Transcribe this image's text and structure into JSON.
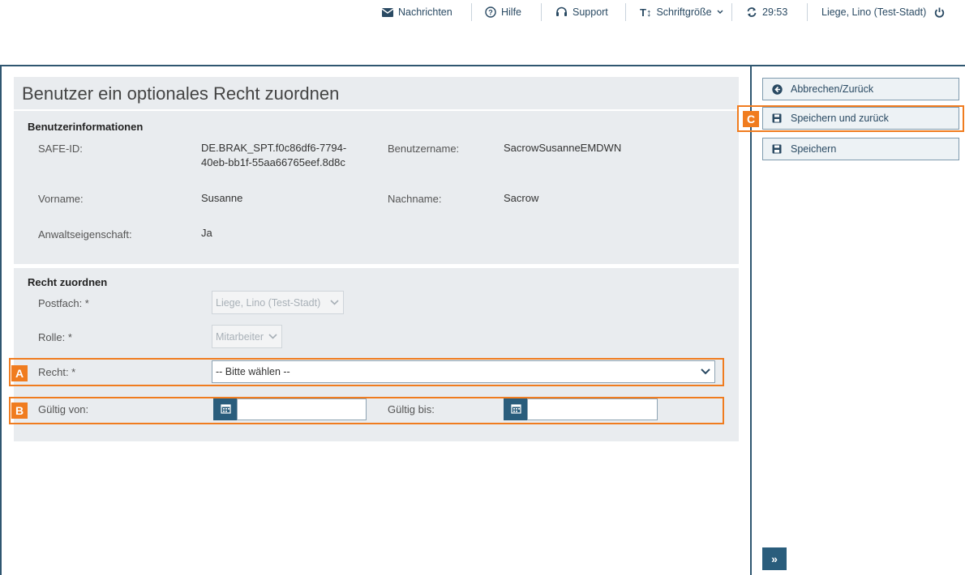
{
  "topbar": {
    "messages": "Nachrichten",
    "help": "Hilfe",
    "support": "Support",
    "font_size": "Schriftgröße",
    "timer": "29:53",
    "user": "Liege, Lino (Test-Stadt)"
  },
  "page": {
    "title": "Benutzer ein optionales Recht zuordnen"
  },
  "user_info": {
    "heading": "Benutzerinformationen",
    "safe_id_label": "SAFE-ID:",
    "safe_id_line1": "DE.BRAK_SPT.f0c86df6-7794-",
    "safe_id_line2": "40eb-bb1f-55aa66765eef.8d8c",
    "username_label": "Benutzername:",
    "username_value": "SacrowSusanneEMDWN",
    "firstname_label": "Vorname:",
    "firstname_value": "Susanne",
    "lastname_label": "Nachname:",
    "lastname_value": "Sacrow",
    "attorney_label": "Anwaltseigenschaft:",
    "attorney_value": "Ja"
  },
  "assign": {
    "heading": "Recht zuordnen",
    "mailbox_label": "Postfach: *",
    "mailbox_value": "Liege, Lino (Test-Stadt)",
    "role_label": "Rolle: *",
    "role_value": "Mitarbeiter",
    "right_label": "Recht: *",
    "right_value": "-- Bitte wählen --",
    "valid_from_label": "Gültig von:",
    "valid_from_value": "",
    "valid_to_label": "Gültig bis:",
    "valid_to_value": ""
  },
  "actions": {
    "cancel": "Abbrechen/Zurück",
    "save_back": "Speichern und zurück",
    "save": "Speichern",
    "expand": "»"
  },
  "markers": {
    "a": "A",
    "b": "B",
    "c": "C"
  },
  "colors": {
    "accent": "#2a5d7c",
    "highlight": "#f07c1f",
    "panel": "#e9ecef"
  }
}
